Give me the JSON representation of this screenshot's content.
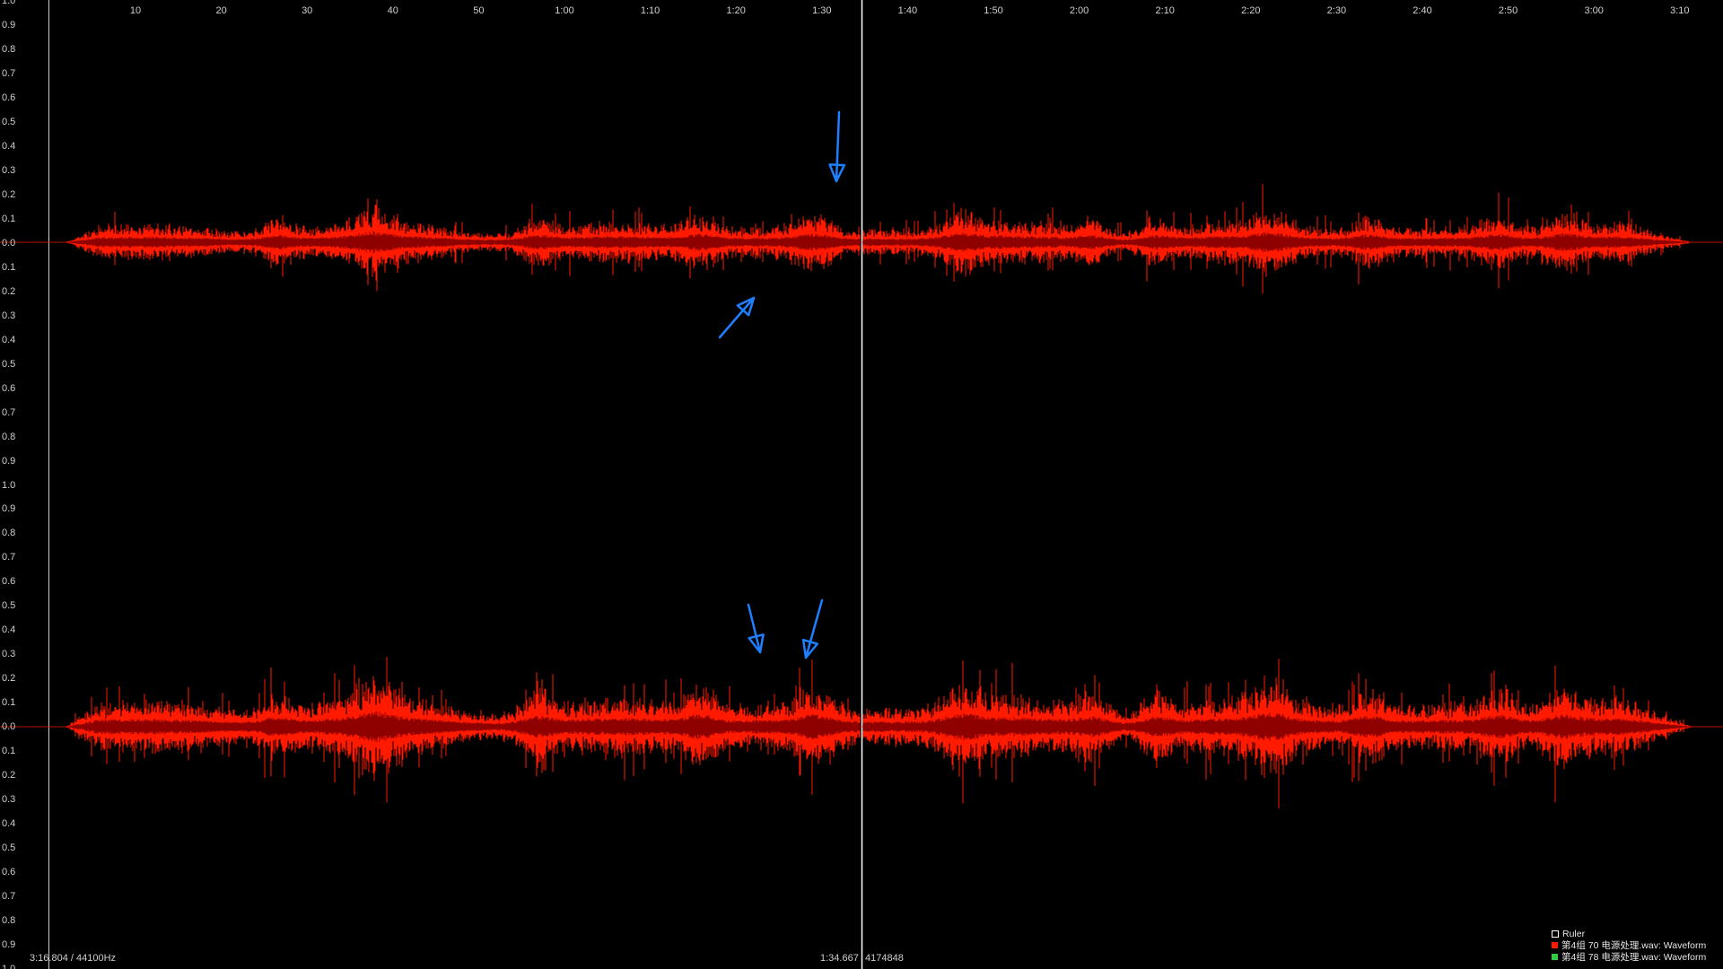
{
  "colors": {
    "background": "#000000",
    "waveform": "#ff1a00",
    "waveform_core": "#8f0000",
    "annotation_arrow": "#1e7fff",
    "cursor_line": "#ffffff",
    "text": "#d0d0d0",
    "legend_track1": "#ff1a00",
    "legend_track2": "#2ecc40"
  },
  "ruler": {
    "labels": [
      "10",
      "20",
      "30",
      "40",
      "50",
      "1:00",
      "1:10",
      "1:20",
      "1:30",
      "1:40",
      "1:50",
      "2:00",
      "2:10",
      "2:20",
      "2:30",
      "2:40",
      "2:50",
      "3:00",
      "3:10"
    ]
  },
  "amplitude_scale": {
    "upper_track_labels": [
      "1.0",
      "0.9",
      "0.8",
      "0.7",
      "0.6",
      "0.5",
      "0.4",
      "0.3",
      "0.2",
      "0.1",
      "0.0",
      "0.1",
      "0.2",
      "0.3",
      "0.4",
      "0.5",
      "0.6",
      "0.7",
      "0.8",
      "0.9",
      "1.0"
    ],
    "lower_track_labels": [
      "0.9",
      "0.8",
      "0.7",
      "0.6",
      "0.5",
      "0.4",
      "0.3",
      "0.2",
      "0.1",
      "0.0",
      "0.1",
      "0.2",
      "0.3",
      "0.4",
      "0.5",
      "0.6",
      "0.7",
      "0.8",
      "0.9",
      "1.0"
    ]
  },
  "status": {
    "duration_and_rate": "3:16.804 / 44100Hz",
    "cursor_time": "1:34.667",
    "cursor_sample": "4174848"
  },
  "legend": {
    "ruler_label": "Ruler",
    "track1_label": "第4组 70 电源处理.wav: Waveform",
    "track2_label": "第4组 78 电源处理.wav: Waveform"
  },
  "tracks": [
    {
      "name": "track-1-waveform",
      "seed": 7
    },
    {
      "name": "track-2-waveform",
      "seed": 13
    }
  ],
  "annotation_arrows": [
    {
      "name": "arrow-down-upper-track"
    },
    {
      "name": "arrow-up-upper-track"
    },
    {
      "name": "arrow-down-lower-track-left"
    },
    {
      "name": "arrow-down-lower-track-right"
    }
  ]
}
